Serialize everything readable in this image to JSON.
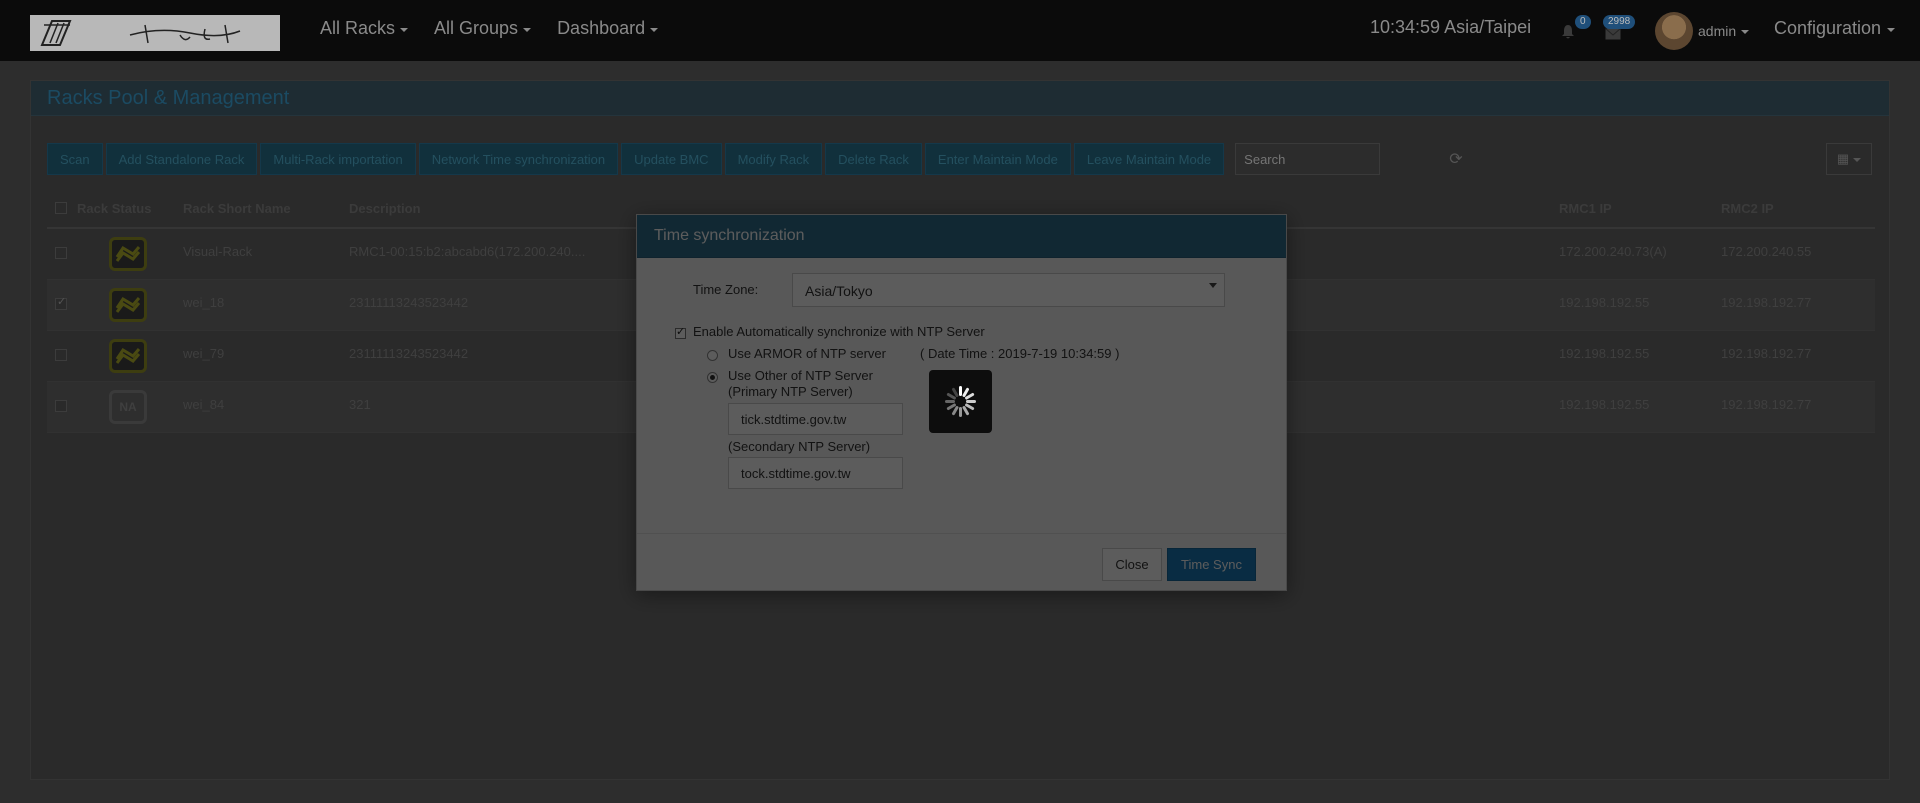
{
  "navbar": {
    "menu": [
      {
        "label": "All Racks"
      },
      {
        "label": "All Groups"
      },
      {
        "label": "Dashboard"
      }
    ],
    "clock": "10:34:59 Asia/Taipei",
    "badge_alerts": "0",
    "badge_events": "2998",
    "user": "admin",
    "configuration": "Configuration",
    "icons": [
      "bell-icon",
      "envelope-icon"
    ]
  },
  "panel": {
    "title": "Racks Pool & Management",
    "toolbar": [
      "Scan",
      "Add Standalone Rack",
      "Multi-Rack importation",
      "Network Time synchronization",
      "Update BMC",
      "Modify Rack",
      "Delete Rack",
      "Enter Maintain Mode",
      "Leave Maintain Mode"
    ],
    "search_placeholder": "Search"
  },
  "table": {
    "headers": {
      "status": "Rack Status",
      "name": "Rack Short Name",
      "description": "Description",
      "rmc1": "RMC1 IP",
      "rmc2": "RMC2 IP"
    },
    "rows": [
      {
        "checked": false,
        "status": "ok",
        "name": "Visual-Rack",
        "description": "RMC1-00:15:b2:abcabd6(172.200.240....",
        "rmc1": "172.200.240.73(A)",
        "rmc2": "172.200.240.55"
      },
      {
        "checked": true,
        "status": "ok",
        "name": "wei_18",
        "description": "23111113243523442",
        "rmc1": "192.198.192.55",
        "rmc2": "192.198.192.77"
      },
      {
        "checked": false,
        "status": "ok",
        "name": "wei_79",
        "description": "23111113243523442",
        "rmc1": "192.198.192.55",
        "rmc2": "192.198.192.77"
      },
      {
        "checked": false,
        "status": "na",
        "status_text": "NA",
        "name": "wei_84",
        "description": "321",
        "rmc1": "192.198.192.55",
        "rmc2": "192.198.192.77"
      }
    ]
  },
  "modal": {
    "title": "Time synchronization",
    "timezone_label": "Time Zone:",
    "timezone_value": "Asia/Tokyo",
    "enable_ntp_label": "Enable Automatically synchronize with NTP Server",
    "enable_ntp_checked": true,
    "use_armor_label": "Use ARMOR of NTP server",
    "date_time": "( Date Time : 2019-7-19 10:34:59 )",
    "use_other_label": "Use Other of NTP Server",
    "primary_label": "(Primary NTP Server)",
    "primary_value": "tick.stdtime.gov.tw",
    "secondary_label": "(Secondary NTP Server)",
    "secondary_value": "tock.stdtime.gov.tw",
    "close_label": "Close",
    "sync_label": "Time Sync"
  },
  "colors": {
    "navbar_bg": "#0b0b0b",
    "modal_header": "#2f6e8e",
    "primary_button": "#1a7bb9"
  }
}
